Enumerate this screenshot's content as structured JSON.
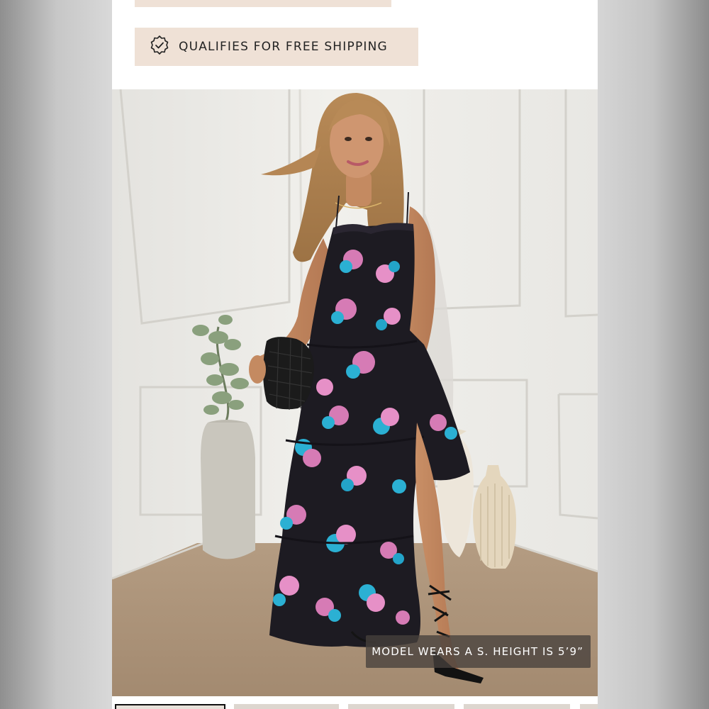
{
  "shipping": {
    "label": "QUALIFIES FOR FREE SHIPPING",
    "icon": "badge-check-icon"
  },
  "product_image": {
    "caption": "MODEL WEARS A S. HEIGHT IS 5’9”",
    "accent": "#efe1d6"
  },
  "thumbnails": {
    "count": 5,
    "selected_index": 0
  }
}
